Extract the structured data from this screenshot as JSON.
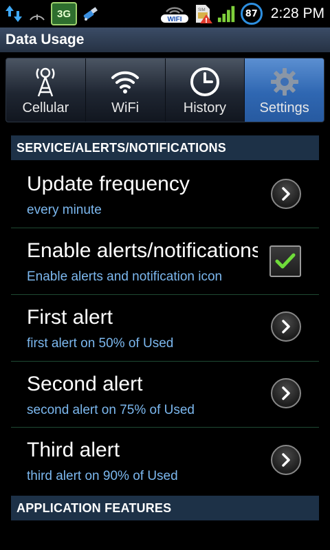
{
  "statusbar": {
    "network_badge": "3G",
    "battery_level": "87",
    "time": "2:28 PM",
    "wifi_badge": "WIFI",
    "sim_badge": "SIM"
  },
  "titlebar": {
    "title": "Data Usage"
  },
  "tabs": [
    {
      "label": "Cellular",
      "icon": "cell-tower-icon",
      "active": false
    },
    {
      "label": "WiFi",
      "icon": "wifi-icon",
      "active": false
    },
    {
      "label": "History",
      "icon": "clock-icon",
      "active": false
    },
    {
      "label": "Settings",
      "icon": "gear-icon",
      "active": true
    }
  ],
  "sections": {
    "service": "SERVICE/ALERTS/NOTIFICATIONS",
    "app_features": "APPLICATION FEATURES"
  },
  "settings": [
    {
      "title": "Update frequency",
      "subtitle": "every minute",
      "control": "chevron"
    },
    {
      "title": "Enable alerts/notifications",
      "subtitle": "Enable alerts and notification icon",
      "control": "checkbox",
      "checked": true
    },
    {
      "title": "First alert",
      "subtitle": "first alert on 50% of Used",
      "control": "chevron"
    },
    {
      "title": "Second alert",
      "subtitle": "second alert on 75% of Used",
      "control": "chevron"
    },
    {
      "title": "Third alert",
      "subtitle": "third alert on 90% of Used",
      "control": "chevron"
    }
  ],
  "colors": {
    "accent_tab": "#2f67b2",
    "section_bg": "#1d3147",
    "subtitle": "#7cb8ef",
    "check": "#6fdc3a"
  }
}
